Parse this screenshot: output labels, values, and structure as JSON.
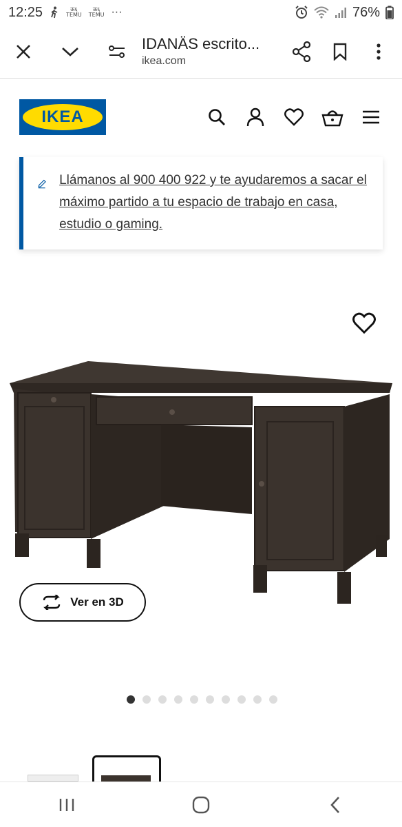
{
  "status": {
    "time": "12:25",
    "app_badge_1": "TEMU",
    "app_badge_2": "TEMU",
    "more": "···",
    "battery": "76%"
  },
  "browser": {
    "title": "IDANÄS escrito...",
    "url": "ikea.com"
  },
  "header": {
    "logo_text": "IKEA"
  },
  "banner": {
    "text": "Llámanos al 900 400 922 y te ayudaremos a sacar el máximo partido a tu espacio de trabajo en casa, estudio o gaming."
  },
  "product": {
    "view3d_label": "Ver en 3D",
    "carousel": {
      "total": 10,
      "active_index": 1
    }
  },
  "colors": {
    "ikea_blue": "#0058a3",
    "ikea_yellow": "#ffdb00",
    "desk": "#3b332d"
  }
}
